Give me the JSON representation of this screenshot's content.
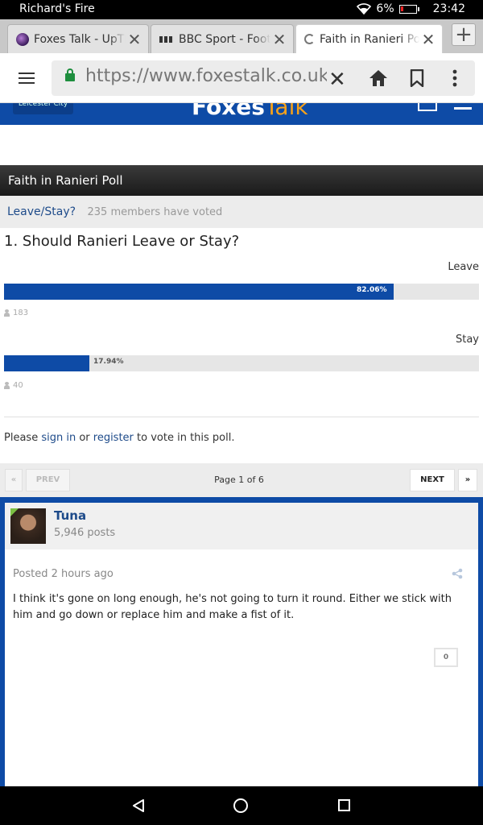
{
  "status": {
    "device": "Richard's Fire",
    "battery": "6%",
    "time": "23:42"
  },
  "tabs": [
    {
      "title": "Foxes Talk - UpThe",
      "icon": "globe-favicon"
    },
    {
      "title": "BBC Sport - Footba",
      "icon": "bbc-favicon"
    },
    {
      "title": "Faith in Ranieri Poll",
      "icon": "loading-spinner"
    }
  ],
  "address": {
    "url": "https://www.foxestalk.co.uk/fo"
  },
  "site": {
    "badge": "Leicester City",
    "logo_main": "Foxes",
    "logo_accent": "Talk"
  },
  "poll": {
    "title": "Faith in Ranieri Poll",
    "name": "Leave/Stay?",
    "votes_text": "235 members have voted",
    "question": "1. Should Ranieri Leave or Stay?",
    "choices": [
      {
        "label": "Leave",
        "percent_text": "82.06%",
        "fraction": 0.8206,
        "voters": "183"
      },
      {
        "label": "Stay",
        "percent_text": "17.94%",
        "fraction": 0.1794,
        "voters": "40"
      }
    ],
    "note_prefix": "Please ",
    "note_signin": "sign in",
    "note_mid": " or ",
    "note_register": "register",
    "note_suffix": " to vote in this poll."
  },
  "pager": {
    "prev": "PREV",
    "next": "NEXT",
    "page_text": "Page 1 of 6",
    "first": "«",
    "last": "»"
  },
  "post": {
    "author": "Tuna",
    "post_count": "5,946 posts",
    "posted": "Posted 2 hours ago",
    "body": "I think it's gone on long enough, he's not going to turn it round. Either we stick with him and go down or replace him and make a fist of it.",
    "reputation": "0"
  },
  "colors": {
    "brand_blue": "#0e4ba6",
    "link_blue": "#1e4b8a",
    "secure_green": "#1e8e3e"
  }
}
